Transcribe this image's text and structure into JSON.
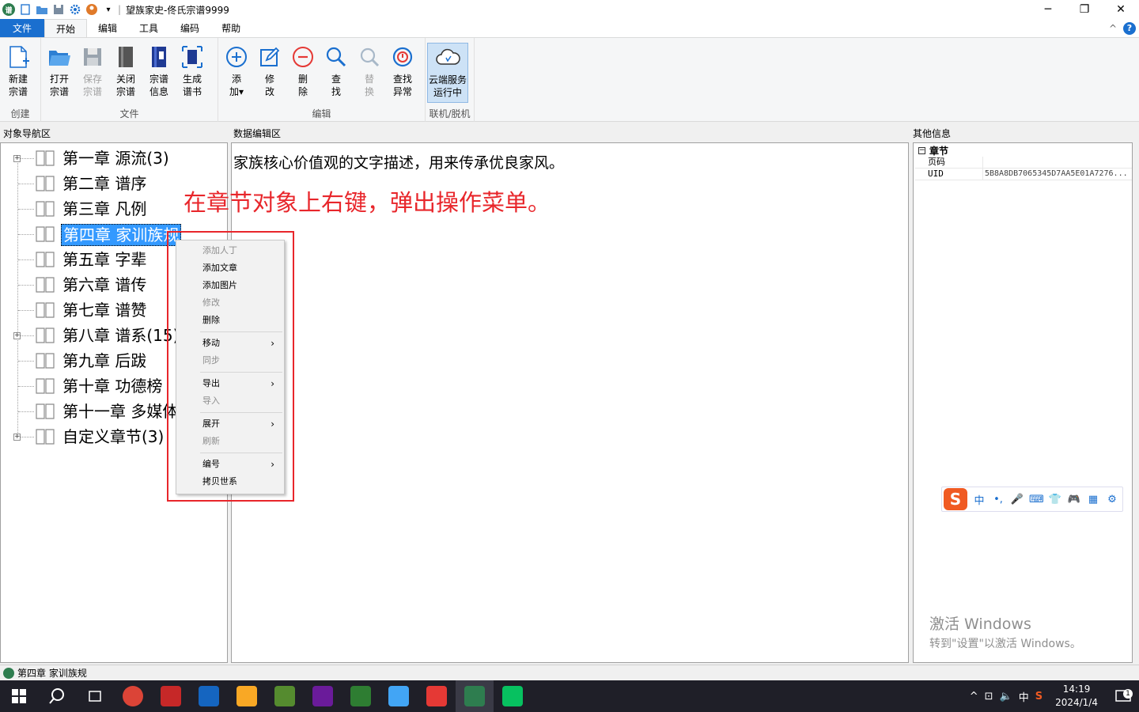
{
  "window": {
    "title": "望族家史-佟氏宗谱9999",
    "minimize": "─",
    "restore": "❐",
    "close": "✕"
  },
  "menu": {
    "file": "文件",
    "tabs": [
      "开始",
      "编辑",
      "工具",
      "编码",
      "帮助"
    ],
    "collapse": "^",
    "help": "?"
  },
  "ribbon": {
    "groups": [
      {
        "label": "创建",
        "buttons": [
          {
            "label": "新建\n宗谱",
            "icon": "new-file-icon",
            "disabled": false
          }
        ]
      },
      {
        "label": "文件",
        "buttons": [
          {
            "label": "打开\n宗谱",
            "icon": "open-folder-icon",
            "disabled": false
          },
          {
            "label": "保存\n宗谱",
            "icon": "save-icon",
            "disabled": true
          },
          {
            "label": "关闭\n宗谱",
            "icon": "close-book-icon",
            "disabled": false
          },
          {
            "label": "宗谱\n信息",
            "icon": "book-info-icon",
            "disabled": false
          },
          {
            "label": "生成\n谱书",
            "icon": "generate-book-icon",
            "disabled": false
          }
        ]
      },
      {
        "label": "编辑",
        "buttons": [
          {
            "label": "添\n加▾",
            "icon": "add-icon",
            "disabled": false
          },
          {
            "label": "修\n改",
            "icon": "edit-icon",
            "disabled": false
          },
          {
            "label": "删\n除",
            "icon": "delete-icon",
            "disabled": false
          },
          {
            "label": "查\n找",
            "icon": "search-icon",
            "disabled": false
          },
          {
            "label": "替\n换",
            "icon": "replace-icon",
            "disabled": true
          },
          {
            "label": "查找\n异常",
            "icon": "find-error-icon",
            "disabled": false
          }
        ]
      },
      {
        "label": "联机/脱机",
        "buttons": [
          {
            "label": "云端服务\n运行中",
            "icon": "cloud-icon",
            "disabled": false
          }
        ]
      }
    ]
  },
  "panels": {
    "nav_title": "对象导航区",
    "edit_title": "数据编辑区",
    "info_title": "其他信息"
  },
  "tree": [
    {
      "label": "第一章 源流(3)",
      "expandable": true,
      "selected": false
    },
    {
      "label": "第二章 谱序",
      "expandable": false,
      "selected": false
    },
    {
      "label": "第三章 凡例",
      "expandable": false,
      "selected": false
    },
    {
      "label": "第四章 家训族规",
      "expandable": false,
      "selected": true
    },
    {
      "label": "第五章 字辈",
      "expandable": false,
      "selected": false
    },
    {
      "label": "第六章 谱传",
      "expandable": false,
      "selected": false
    },
    {
      "label": "第七章 谱赞",
      "expandable": false,
      "selected": false
    },
    {
      "label": "第八章 谱系(15)",
      "expandable": true,
      "selected": false
    },
    {
      "label": "第九章 后跋",
      "expandable": false,
      "selected": false
    },
    {
      "label": "第十章 功德榜",
      "expandable": false,
      "selected": false
    },
    {
      "label": "第十一章 多媒体",
      "expandable": false,
      "selected": false
    },
    {
      "label": "自定义章节(3)",
      "expandable": true,
      "selected": false
    }
  ],
  "editor": {
    "text": "家族核心价值观的文字描述，用来传承优良家风。",
    "annotation": "在章节对象上右键，弹出操作菜单。"
  },
  "context_menu": {
    "groups": [
      [
        {
          "label": "添加人丁",
          "disabled": true,
          "submenu": false
        },
        {
          "label": "添加文章",
          "disabled": false,
          "submenu": false
        },
        {
          "label": "添加图片",
          "disabled": false,
          "submenu": false
        },
        {
          "label": "修改",
          "disabled": true,
          "submenu": false
        },
        {
          "label": "删除",
          "disabled": false,
          "submenu": false
        }
      ],
      [
        {
          "label": "移动",
          "disabled": false,
          "submenu": true
        },
        {
          "label": "同步",
          "disabled": true,
          "submenu": false
        }
      ],
      [
        {
          "label": "导出",
          "disabled": false,
          "submenu": true
        },
        {
          "label": "导入",
          "disabled": true,
          "submenu": false
        }
      ],
      [
        {
          "label": "展开",
          "disabled": false,
          "submenu": true
        },
        {
          "label": "刷新",
          "disabled": true,
          "submenu": false
        }
      ],
      [
        {
          "label": "编号",
          "disabled": false,
          "submenu": true
        },
        {
          "label": "拷贝世系",
          "disabled": false,
          "submenu": false
        }
      ]
    ],
    "arrow": "›"
  },
  "properties": {
    "category": "章节",
    "collapse": "⊟",
    "rows": [
      {
        "key": "页码",
        "value": ""
      },
      {
        "key": "UID",
        "value": "5B8A8DB7065345D7AA5E01A7276..."
      }
    ]
  },
  "ime": {
    "logo": "S",
    "items": [
      "中",
      "•,",
      "🎤",
      "⌨",
      "👕",
      "🎮",
      "▦",
      "⚙"
    ]
  },
  "activation": {
    "line1": "激活 Windows",
    "line2": "转到\"设置\"以激活 Windows。"
  },
  "status": {
    "text": "第四章 家训族规"
  },
  "taskbar": {
    "tray_icons": [
      "^",
      "⊡",
      "🔈",
      "中",
      "S"
    ],
    "time": "14:19",
    "date": "2024/1/4",
    "notifications": "1",
    "app_colors": [
      "#db4437",
      "#c62828",
      "#1565c0",
      "#f9a825",
      "#558b2f",
      "#6a1b9a",
      "#2e7d32",
      "#42a5f5",
      "#e53935",
      "#2e7d4f",
      "#07c160"
    ]
  }
}
